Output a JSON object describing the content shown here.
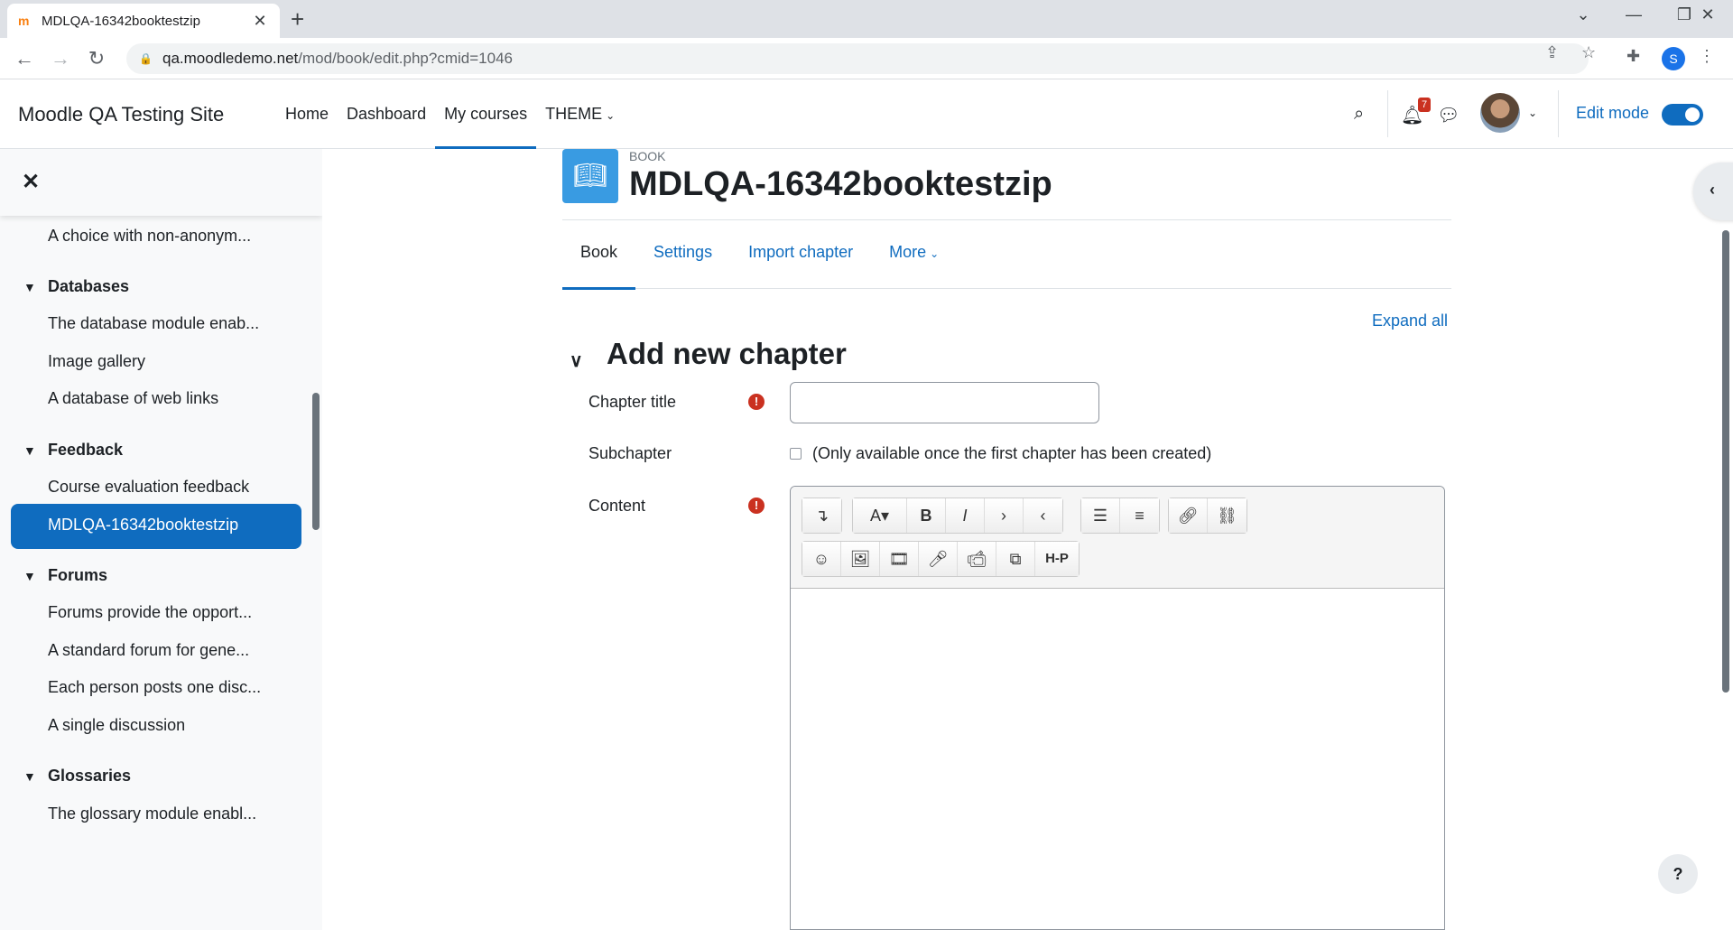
{
  "browser": {
    "tab_title": "MDLQA-16342booktestzip",
    "url_host": "qa.moodledemo.net",
    "url_path": "/mod/book/edit.php?cmid=1046",
    "profile_initial": "S"
  },
  "navbar": {
    "site_name": "Moodle QA Testing Site",
    "items": [
      {
        "label": "Home"
      },
      {
        "label": "Dashboard"
      },
      {
        "label": "My courses"
      },
      {
        "label": "THEME"
      }
    ],
    "notification_count": "7",
    "edit_mode_label": "Edit mode"
  },
  "drawer": {
    "truncated_top": "A choice with non-anonym...",
    "sections": [
      {
        "title": "Databases",
        "items": [
          "The database module enab...",
          "Image gallery",
          "A database of web links"
        ]
      },
      {
        "title": "Feedback",
        "items": [
          "Course evaluation feedback",
          "MDLQA-16342booktestzip"
        ]
      },
      {
        "title": "Forums",
        "items": [
          "Forums provide the opport...",
          "A standard forum for gene...",
          "Each person posts one disc...",
          "A single discussion"
        ]
      },
      {
        "title": "Glossaries",
        "items": [
          "The glossary module enabl..."
        ]
      }
    ]
  },
  "page": {
    "activity_type": "BOOK",
    "title": "MDLQA-16342booktestzip",
    "tabs": [
      {
        "label": "Book"
      },
      {
        "label": "Settings"
      },
      {
        "label": "Import chapter"
      },
      {
        "label": "More"
      }
    ],
    "expand_all": "Expand all",
    "fieldset_title": "Add new chapter",
    "fields": {
      "chapter_title_label": "Chapter title",
      "chapter_title_value": "",
      "subchapter_label": "Subchapter",
      "subchapter_note": "(Only available once the first chapter has been created)",
      "content_label": "Content"
    },
    "help_label": "?"
  }
}
